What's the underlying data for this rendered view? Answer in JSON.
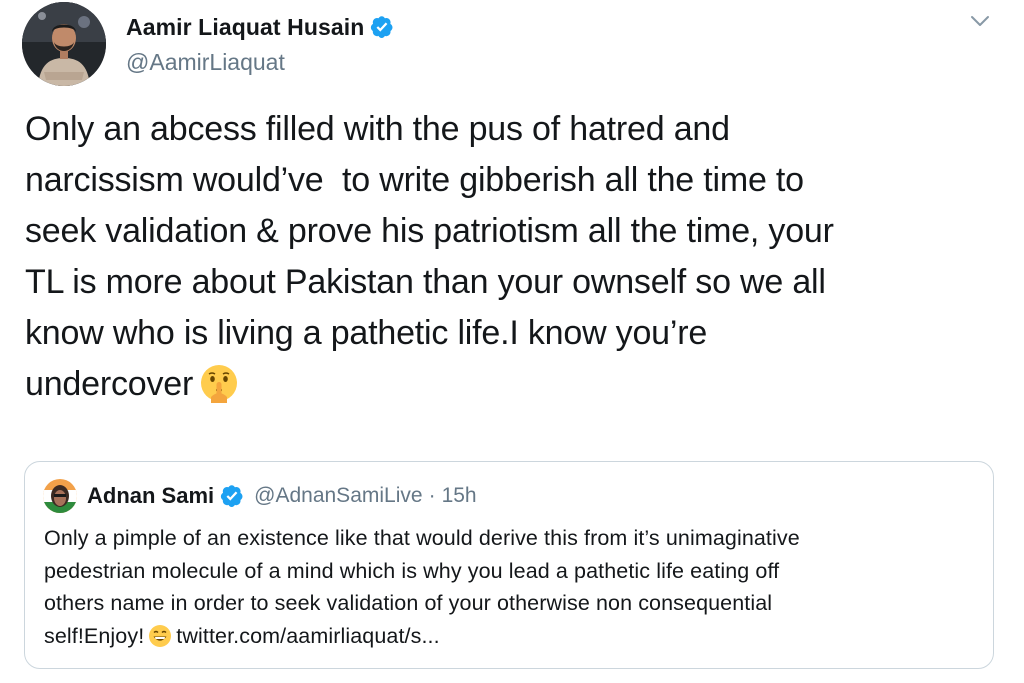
{
  "tweet": {
    "author": {
      "display_name": "Aamir Liaquat Husain",
      "handle": "@AamirLiaquat",
      "verified": true
    },
    "menu_icon": "chevron-down-icon",
    "text": "Only an abcess filled with the pus of hatred and\nnarcissism would’ve  to write gibberish all the time to\nseek validation & prove his patriotism all the time, your\nTL is more about Pakistan than your ownself so we all\nknow who is living a pathetic life.I know you’re\nundercover",
    "text_emoji": "shushing-face-emoji"
  },
  "quoted_tweet": {
    "author": {
      "display_name": "Adnan Sami",
      "handle": "@AdnanSamiLive",
      "verified": true
    },
    "separator": "·",
    "time": "15h",
    "text": "Only a pimple of an existence like that would derive this from it’s unimaginative\npedestrian molecule of a mind which is why you lead a pathetic life eating off\nothers name in order to seek validation of your otherwise non consequential\nself!Enjoy!",
    "emoji": "grinning-face-emoji",
    "link": "twitter.com/aamirliaquat/s..."
  },
  "colors": {
    "verified_blue": "#1da1f2",
    "text_primary": "#14171a",
    "text_secondary": "#657786",
    "border": "#ccd6dd"
  }
}
